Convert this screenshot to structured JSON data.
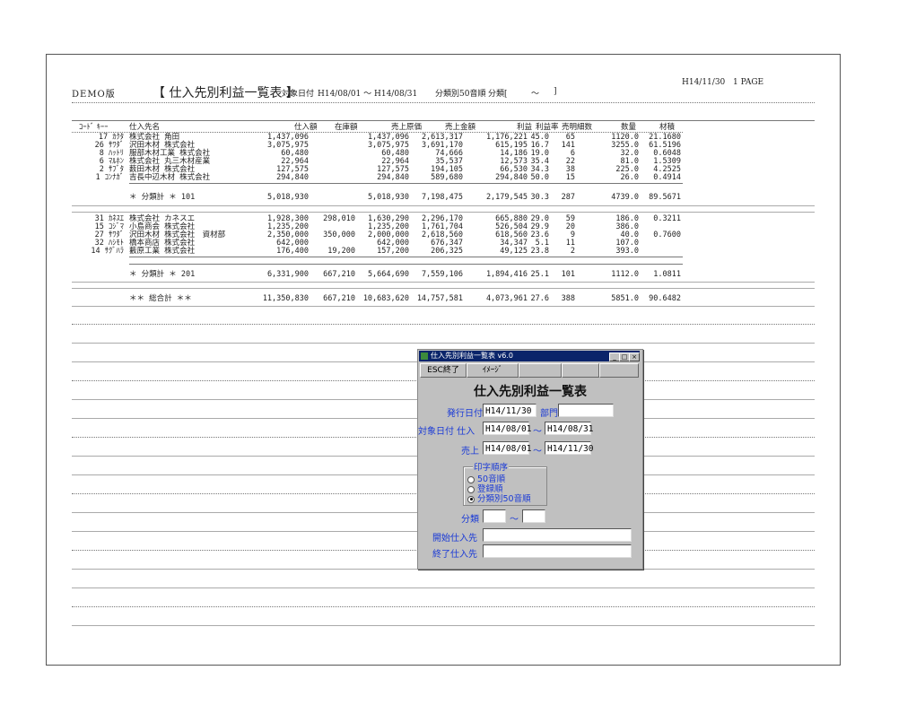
{
  "report": {
    "demo_label": "DEMO版",
    "title": "【 仕入先別利益一覧表 】",
    "target_date_label": "対象日付",
    "target_date_range": "H14/08/01 ～ H14/08/31",
    "order_label": "分類別50音順",
    "category_label": "分類[",
    "category_tilde": "～",
    "category_close": "]",
    "print_date": "H14/11/30",
    "page": "1 PAGE"
  },
  "table": {
    "headers": [
      "ｺｰﾄﾞ ｷｰｰ",
      "仕入先名",
      "仕入額",
      "在庫額",
      "売上原価",
      "売上金額",
      "利益",
      "利益率",
      "売明細数",
      "数量",
      "材積"
    ],
    "group1_rows": [
      [
        "17 ｶｸﾀ",
        "株式会社 角田",
        "1,437,096",
        "",
        "1,437,096",
        "2,613,317",
        "1,176,221",
        "45.0",
        "65",
        "1120.0",
        "21.1680"
      ],
      [
        "26 ｻﾜﾀﾞ",
        "沢田木材 株式会社",
        "3,075,975",
        "",
        "3,075,975",
        "3,691,170",
        "615,195",
        "16.7",
        "141",
        "3255.0",
        "61.5196"
      ],
      [
        "8 ﾊｯﾄﾘ",
        "服部木材工業 株式会社",
        "60,480",
        "",
        "60,480",
        "74,666",
        "14,186",
        "19.0",
        "6",
        "32.0",
        "0.6048"
      ],
      [
        "6 ﾏﾙﾎﾝ",
        "株式会社 丸三木材産業",
        "22,964",
        "",
        "22,964",
        "35,537",
        "12,573",
        "35.4",
        "22",
        "81.0",
        "1.5309"
      ],
      [
        "2 ｻﾌﾞﾀ",
        "薮田木材 株式会社",
        "127,575",
        "",
        "127,575",
        "194,105",
        "66,530",
        "34.3",
        "38",
        "225.0",
        "4.2525"
      ],
      [
        "1 ｺﾝﾅｶﾞ",
        "吉長中辺木材 株式会社",
        "294,840",
        "",
        "294,840",
        "589,680",
        "294,840",
        "50.0",
        "15",
        "26.0",
        "0.4914"
      ]
    ],
    "group1_subtotal": [
      "＊ 分類計 ＊ 101",
      "5,018,930",
      "",
      "5,018,930",
      "7,198,475",
      "2,179,545",
      "30.3",
      "287",
      "4739.0",
      "89.5671"
    ],
    "group2_rows": [
      [
        "31 ｶﾈｽｴ",
        "株式会社 カネスエ",
        "1,928,300",
        "298,010",
        "1,630,290",
        "2,296,170",
        "665,880",
        "29.0",
        "59",
        "186.0",
        "0.3211"
      ],
      [
        "15 ｺｼﾞﾏ",
        "小島商会 株式会社",
        "1,235,200",
        "",
        "1,235,200",
        "1,761,704",
        "526,504",
        "29.9",
        "20",
        "386.0",
        ""
      ],
      [
        "27 ｻﾜﾀﾞ",
        "沢田木材 株式会社　資材部",
        "2,350,000",
        "350,000",
        "2,000,000",
        "2,618,560",
        "618,560",
        "23.6",
        "9",
        "40.0",
        "0.7600"
      ],
      [
        "32 ﾊｼﾓﾄ",
        "橋本商店 株式会社",
        "642,000",
        "",
        "642,000",
        "676,347",
        "34,347",
        "5.1",
        "11",
        "107.0",
        ""
      ],
      [
        "14 ｻｸﾞﾊﾗ",
        "藪原工業 株式会社",
        "176,400",
        "19,200",
        "157,200",
        "206,325",
        "49,125",
        "23.8",
        "2",
        "393.0",
        ""
      ]
    ],
    "group2_subtotal": [
      "＊ 分類計 ＊ 201",
      "6,331,900",
      "667,210",
      "5,664,690",
      "7,559,106",
      "1,894,416",
      "25.1",
      "101",
      "1112.0",
      "1.0811"
    ],
    "grand_total": [
      "＊＊ 総合計 ＊＊",
      "11,350,830",
      "667,210",
      "10,683,620",
      "14,757,581",
      "4,073,961",
      "27.6",
      "388",
      "5851.0",
      "90.6482"
    ]
  },
  "dialog": {
    "window_title": "仕入先別利益一覧表 v6.0",
    "esc_button": "ESC終了",
    "image_button": "ｲﾒｰｼﾞ",
    "heading": "仕入先別利益一覧表",
    "issue_date_label": "発行日付",
    "issue_date_value": "H14/11/30",
    "dept_label": "部門",
    "dept_value": "",
    "target_label": "対象日付 仕入",
    "purchase_from": "H14/08/01",
    "purchase_to": "H14/08/31",
    "sales_label": "売上",
    "sales_from": "H14/08/01",
    "sales_to": "H14/11/30",
    "tilde": "～",
    "print_order_label": "印字順序",
    "order_options": [
      "50音順",
      "登録順",
      "分類別50音順"
    ],
    "category_label": "分類",
    "start_supplier_label": "開始仕入先",
    "end_supplier_label": "終了仕入先"
  }
}
